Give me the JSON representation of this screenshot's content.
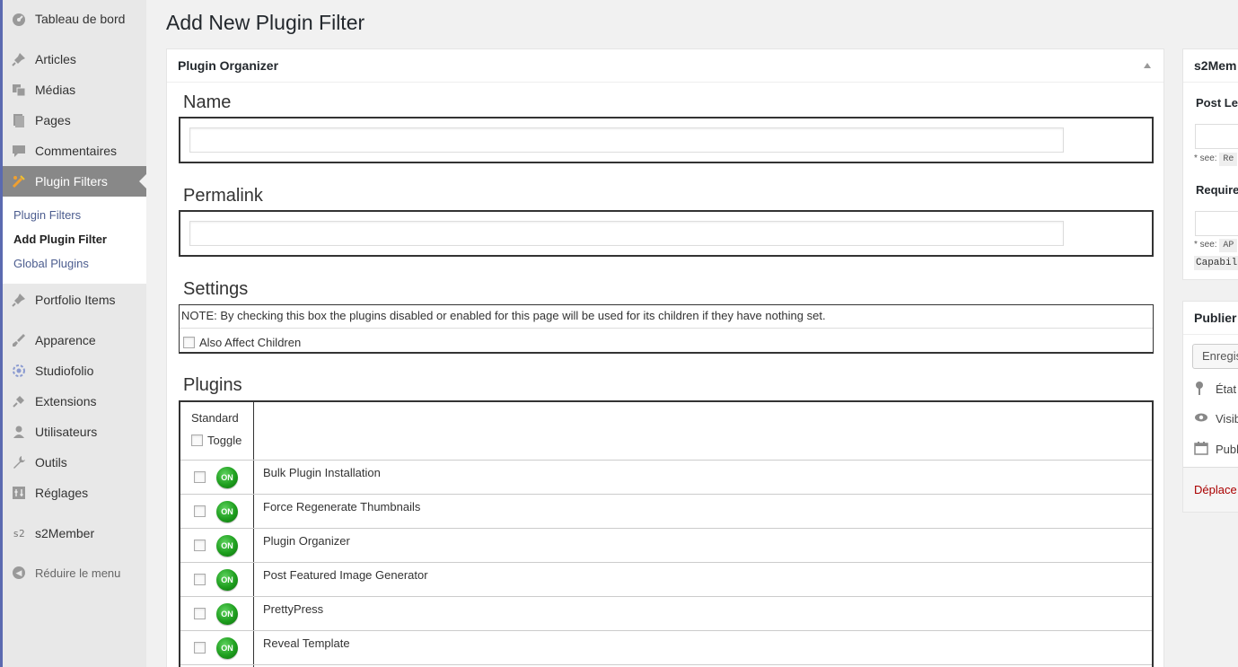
{
  "sidebar": {
    "items": [
      {
        "label": "Tableau de bord",
        "icon": "dashboard-icon"
      },
      {
        "label": "Articles",
        "icon": "pin-icon"
      },
      {
        "label": "Médias",
        "icon": "media-icon"
      },
      {
        "label": "Pages",
        "icon": "pages-icon"
      },
      {
        "label": "Commentaires",
        "icon": "comment-icon"
      },
      {
        "label": "Plugin Filters",
        "icon": "plugin-filter-icon"
      },
      {
        "label": "Portfolio Items",
        "icon": "pin-icon"
      },
      {
        "label": "Apparence",
        "icon": "brush-icon"
      },
      {
        "label": "Studiofolio",
        "icon": "gear-icon"
      },
      {
        "label": "Extensions",
        "icon": "plug-icon"
      },
      {
        "label": "Utilisateurs",
        "icon": "user-icon"
      },
      {
        "label": "Outils",
        "icon": "wrench-icon"
      },
      {
        "label": "Réglages",
        "icon": "settings-icon"
      },
      {
        "label": "s2Member",
        "icon": "s2-icon"
      }
    ],
    "submenu": [
      "Plugin Filters",
      "Add Plugin Filter",
      "Global Plugins"
    ],
    "collapse_label": "Réduire le menu"
  },
  "page": {
    "title": "Add New Plugin Filter"
  },
  "main_box": {
    "title": "Plugin Organizer",
    "name_label": "Name",
    "name_value": "",
    "permalink_label": "Permalink",
    "permalink_value": "",
    "settings_label": "Settings",
    "settings_note": "NOTE: By checking this box the plugins disabled or enabled for this page will be used for its children if they have nothing set.",
    "also_affect_label": "Also Affect Children",
    "plugins_label": "Plugins",
    "standard_label": "Standard",
    "toggle_label": "Toggle",
    "on_label": "ON",
    "plugins": [
      "Bulk Plugin Installation",
      "Force Regenerate Thumbnails",
      "Plugin Organizer",
      "Post Featured Image Generator",
      "PrettyPress",
      "Reveal Template"
    ]
  },
  "s2_box": {
    "title": "s2Mem",
    "post_level_label": "Post Lev",
    "see1_label": "* see:",
    "see1_code": "Re",
    "require_label": "Require",
    "see2_label": "* see:",
    "see2_code": "AP",
    "capab_code": "Capabil"
  },
  "publish_box": {
    "title": "Publier",
    "save_label": "Enregis",
    "status_label": "État",
    "visibility_label": "Visib",
    "publish_label": "Publ",
    "trash_label": "Déplace"
  }
}
